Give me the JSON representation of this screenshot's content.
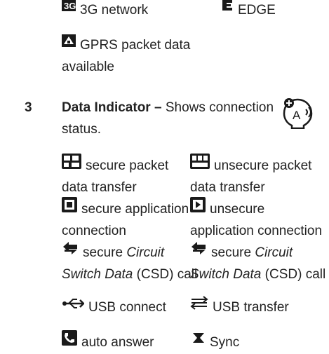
{
  "network": {
    "items": [
      {
        "icon": "3g-icon",
        "label": "3G network"
      },
      {
        "icon": "edge-icon",
        "label": "EDGE"
      },
      {
        "icon": "gprs-icon",
        "label_line1": "GPRS packet data",
        "label_line2": "available"
      }
    ]
  },
  "section": {
    "number": "3",
    "title": "Data Indicator –",
    "desc_line1": "Shows connection",
    "desc_line2": "status."
  },
  "badge": {
    "letter": "A"
  },
  "indicators": [
    {
      "icon": "secure-packet-icon",
      "l1": "secure packet",
      "l2": "data transfer"
    },
    {
      "icon": "unsecure-packet-icon",
      "l1": "unsecure packet",
      "l2": "data transfer"
    },
    {
      "icon": "secure-app-icon",
      "l1": "secure application",
      "l2": "connection"
    },
    {
      "icon": "unsecure-app-icon",
      "l1": "unsecure",
      "l2": "application connection"
    },
    {
      "icon": "csd-icon",
      "l1a": "secure ",
      "l1b": "Circuit",
      "l2a": "Switch Data",
      "l2b": " (CSD) call"
    },
    {
      "icon": "csd-icon",
      "l1a": "secure ",
      "l1b": "Circuit",
      "l2a": "Switch Data",
      "l2b": " (CSD) call"
    },
    {
      "icon": "usb-connect-icon",
      "l1": "USB connect"
    },
    {
      "icon": "usb-transfer-icon",
      "l1": "USB transfer"
    },
    {
      "icon": "auto-answer-icon",
      "l1": "auto answer"
    },
    {
      "icon": "sync-icon",
      "l1": "Sync"
    }
  ]
}
